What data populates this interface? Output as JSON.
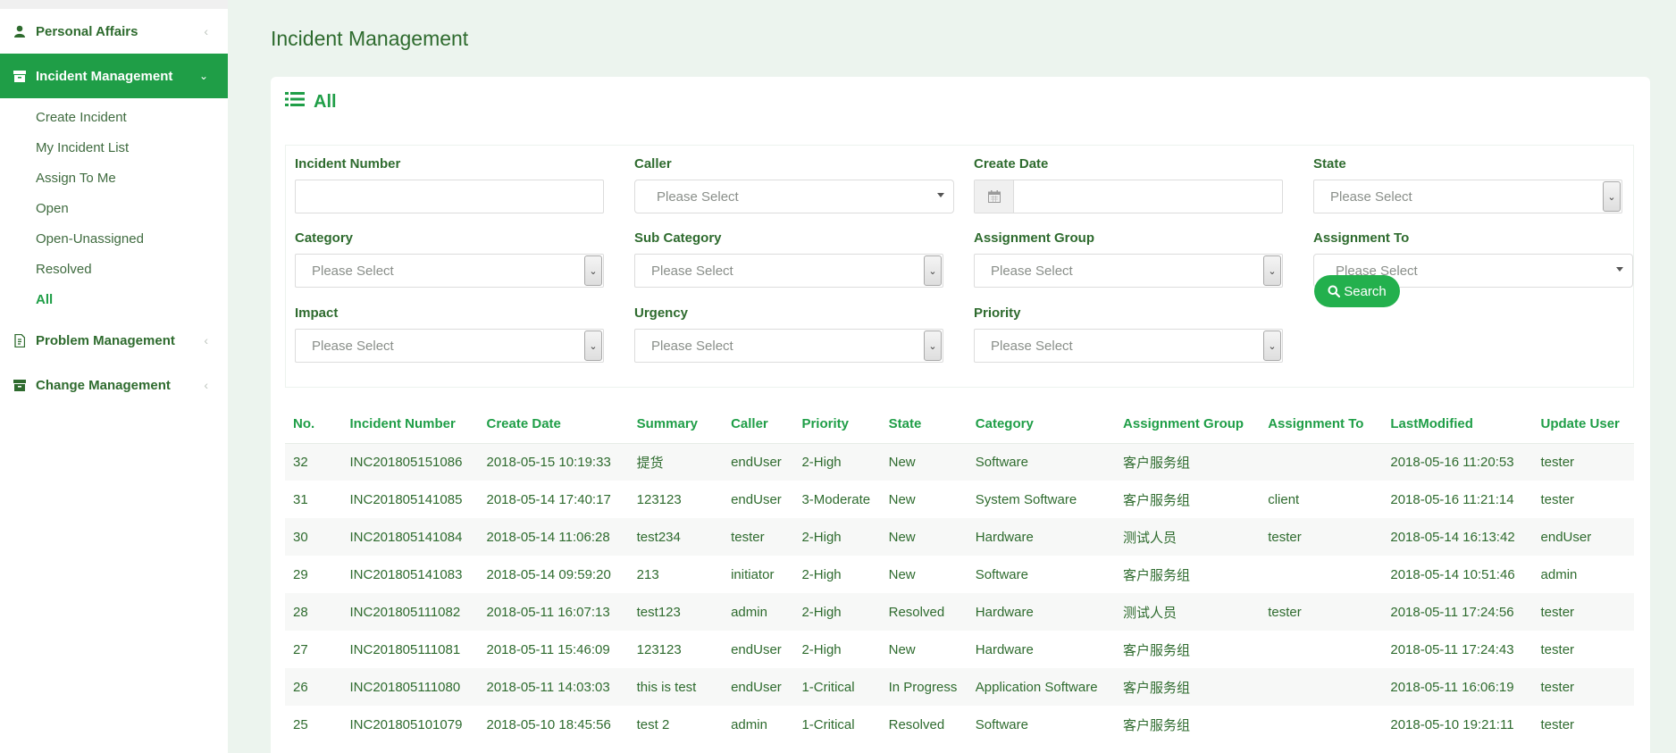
{
  "sidebar": {
    "menus": [
      {
        "label": "Personal Affairs"
      },
      {
        "label": "Incident Management"
      },
      {
        "label": "Problem Management"
      },
      {
        "label": "Change Management"
      }
    ],
    "submenu": [
      "Create Incident",
      "My Incident List",
      "Assign To Me",
      "Open",
      "Open-Unassigned",
      "Resolved",
      "All"
    ]
  },
  "page_title": "Incident Management",
  "card_title": "All",
  "filters": {
    "incident_number": {
      "label": "Incident Number",
      "value": ""
    },
    "caller": {
      "label": "Caller",
      "placeholder": "Please Select"
    },
    "create_date": {
      "label": "Create Date",
      "value": ""
    },
    "state": {
      "label": "State",
      "placeholder": "Please Select"
    },
    "category": {
      "label": "Category",
      "placeholder": "Please Select"
    },
    "sub_category": {
      "label": "Sub Category",
      "placeholder": "Please Select"
    },
    "assignment_group": {
      "label": "Assignment Group",
      "placeholder": "Please Select"
    },
    "assignment_to": {
      "label": "Assignment To",
      "placeholder": "Please Select"
    },
    "impact": {
      "label": "Impact",
      "placeholder": "Please Select"
    },
    "urgency": {
      "label": "Urgency",
      "placeholder": "Please Select"
    },
    "priority": {
      "label": "Priority",
      "placeholder": "Please Select"
    },
    "search_label": "Search"
  },
  "table": {
    "headers": [
      "No.",
      "Incident Number",
      "Create Date",
      "Summary",
      "Caller",
      "Priority",
      "State",
      "Category",
      "Assignment Group",
      "Assignment To",
      "LastModified",
      "Update User"
    ],
    "rows": [
      [
        "32",
        "INC201805151086",
        "2018-05-15 10:19:33",
        "提货",
        "endUser",
        "2-High",
        "New",
        "Software",
        "客户服务组",
        "",
        "2018-05-16 11:20:53",
        "tester"
      ],
      [
        "31",
        "INC201805141085",
        "2018-05-14 17:40:17",
        "123123",
        "endUser",
        "3-Moderate",
        "New",
        "System Software",
        "客户服务组",
        "client",
        "2018-05-16 11:21:14",
        "tester"
      ],
      [
        "30",
        "INC201805141084",
        "2018-05-14 11:06:28",
        "test234",
        "tester",
        "2-High",
        "New",
        "Hardware",
        "测试人员",
        "tester",
        "2018-05-14 16:13:42",
        "endUser"
      ],
      [
        "29",
        "INC201805141083",
        "2018-05-14 09:59:20",
        "213",
        "initiator",
        "2-High",
        "New",
        "Software",
        "客户服务组",
        "",
        "2018-05-14 10:51:46",
        "admin"
      ],
      [
        "28",
        "INC201805111082",
        "2018-05-11 16:07:13",
        "test123",
        "admin",
        "2-High",
        "Resolved",
        "Hardware",
        "测试人员",
        "tester",
        "2018-05-11 17:24:56",
        "tester"
      ],
      [
        "27",
        "INC201805111081",
        "2018-05-11 15:46:09",
        "123123",
        "endUser",
        "2-High",
        "New",
        "Hardware",
        "客户服务组",
        "",
        "2018-05-11 17:24:43",
        "tester"
      ],
      [
        "26",
        "INC201805111080",
        "2018-05-11 14:03:03",
        "this is test",
        "endUser",
        "1-Critical",
        "In Progress",
        "Application Software",
        "客户服务组",
        "",
        "2018-05-11 16:06:19",
        "tester"
      ],
      [
        "25",
        "INC201805101079",
        "2018-05-10 18:45:56",
        "test 2",
        "admin",
        "1-Critical",
        "Resolved",
        "Software",
        "客户服务组",
        "",
        "2018-05-10 19:21:11",
        "tester"
      ]
    ]
  },
  "colors": {
    "accent": "#1f9e47",
    "text": "#2e6b2e",
    "background": "#ecf4ee"
  }
}
